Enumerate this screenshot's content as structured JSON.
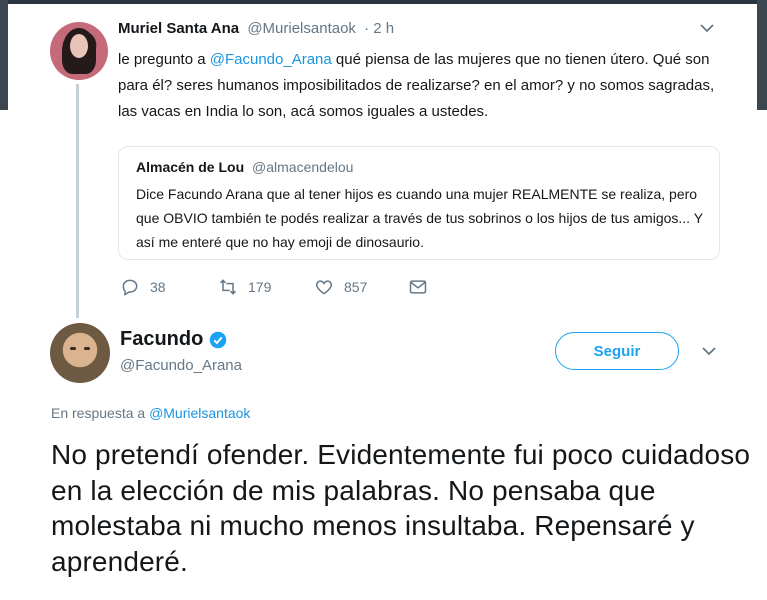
{
  "parent_tweet": {
    "author_name": "Muriel Santa Ana",
    "author_handle": "@Murielsantaok",
    "time": "· 2 h",
    "text_before_mention": "le pregunto a ",
    "mention": "@Facundo_Arana",
    "text_after_mention": " qué piensa de las mujeres que no tienen útero. Qué son para él? seres humanos imposibilitados de realizarse? en el amor? y no somos sagradas, las vacas en India lo son, acá somos iguales a ustedes.",
    "quoted": {
      "author_name": "Almacén de Lou",
      "author_handle": "@almacendelou",
      "text": "Dice Facundo Arana que al tener hijos es cuando una mujer REALMENTE se realiza, pero que OBVIO también te podés realizar a través de tus sobrinos o los hijos de tus amigos... Y así me enteré que no hay emoji de dinosaurio."
    },
    "actions": {
      "replies": "38",
      "retweets": "179",
      "likes": "857"
    }
  },
  "main_tweet": {
    "author_name": "Facundo",
    "author_handle": "@Facundo_Arana",
    "follow_label": "Seguir",
    "reply_prefix": "En respuesta a ",
    "reply_mention": "@Murielsantaok",
    "text": "No pretendí ofender. Evidentemente fui poco cuidadoso en la elección de mis palabras. No pensaba que molestaba ni mucho menos insultaba. Repensaré y aprenderé."
  },
  "icons": [
    "chevron-down-icon",
    "reply-icon",
    "retweet-icon",
    "like-icon",
    "message-icon",
    "verified-badge-icon"
  ],
  "colors": {
    "accent": "#1da1f2",
    "link": "#1b95e0",
    "muted": "#657786",
    "text": "#14171a",
    "border": "#e1e8ed",
    "thread_line": "#c4cfd6"
  }
}
